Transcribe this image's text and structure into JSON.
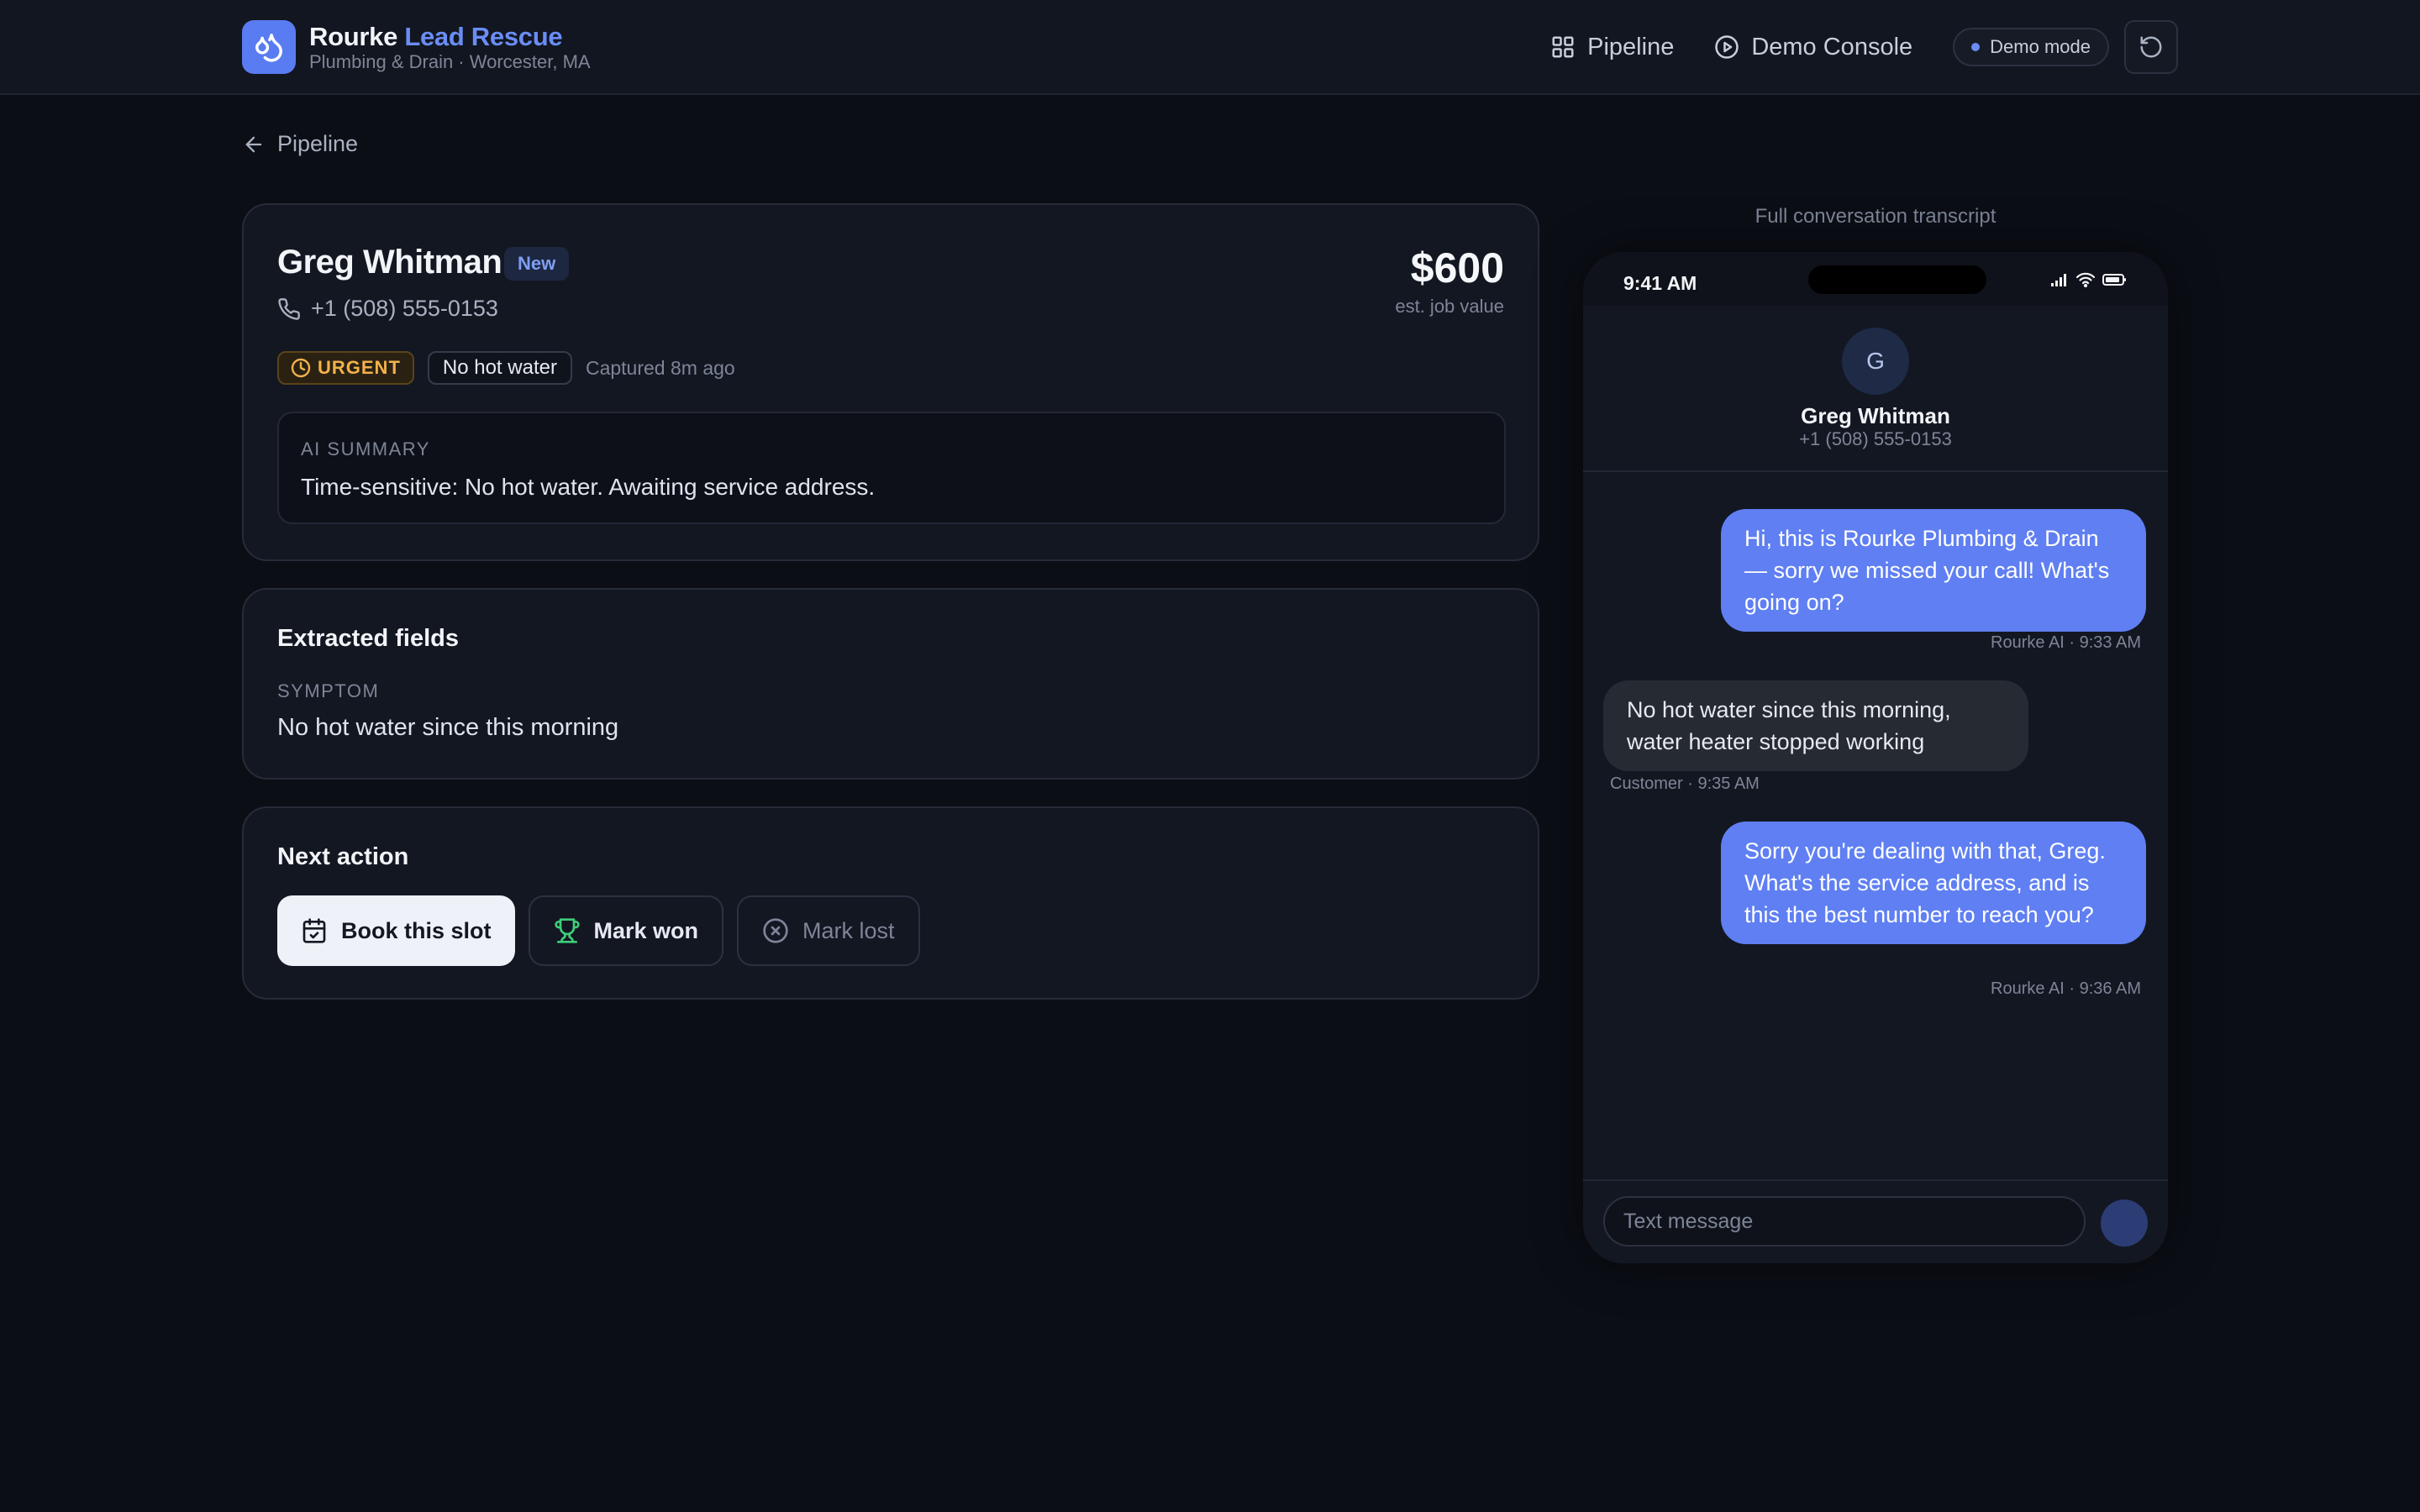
{
  "brand": {
    "name": "Rourke",
    "name_accent": "Lead Rescue",
    "subtitle": "Plumbing & Drain · Worcester, MA"
  },
  "nav": {
    "pipeline": "Pipeline",
    "demo_console": "Demo Console",
    "demo_mode": "Demo mode"
  },
  "back_label": "Pipeline",
  "lead": {
    "name": "Greg Whitman",
    "status": "New",
    "phone": "+1 (508) 555-0153",
    "value": "$600",
    "value_label": "est. job value",
    "urgency": "URGENT",
    "symptom_tag": "No hot water",
    "captured": "Captured 8m ago",
    "summary_label": "AI SUMMARY",
    "summary": "Time-sensitive: No hot water. Awaiting service address."
  },
  "extracted": {
    "title": "Extracted fields",
    "fields": [
      {
        "label": "SYMPTOM",
        "value": "No hot water since this morning"
      }
    ]
  },
  "next_action": {
    "title": "Next action",
    "book": "Book this slot",
    "won": "Mark won",
    "lost": "Mark lost"
  },
  "transcript": {
    "label": "Full conversation transcript",
    "status_time": "9:41 AM",
    "contact_initial": "G",
    "contact_name": "Greg Whitman",
    "contact_phone": "+1 (508) 555-0153",
    "messages": [
      {
        "from": "out",
        "text": "Hi, this is Rourke Plumbing & Drain — sorry we missed your call! What's going on?",
        "meta": "Rourke AI · 9:33 AM"
      },
      {
        "from": "in",
        "text": "No hot water since this morning, water heater stopped working",
        "meta": "Customer · 9:35 AM"
      },
      {
        "from": "out",
        "text": "Sorry you're dealing with that, Greg. What's the service address, and is this the best number to reach you?",
        "meta": "Rourke AI · 9:36 AM"
      }
    ],
    "input_placeholder": "Text message"
  },
  "colors": {
    "accent": "#5f7ff2",
    "urgent": "#f2b24a",
    "won": "#3fcf7a",
    "background": "#0b0e15"
  },
  "icons": {
    "logo": "droplets-icon",
    "pipeline": "grid-icon",
    "demo_console": "play-circle-icon",
    "reset": "refresh-icon",
    "back": "arrow-left-icon",
    "phone": "phone-icon",
    "urgent": "clock-icon",
    "book": "calendar-check-icon",
    "won": "trophy-icon",
    "lost": "x-circle-icon"
  }
}
